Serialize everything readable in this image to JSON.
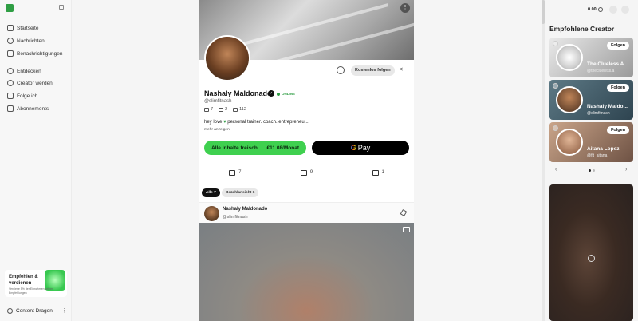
{
  "sidebar": {
    "nav": [
      {
        "label": "Startseite",
        "icon": "home-icon"
      },
      {
        "label": "Nachrichten",
        "icon": "chat-icon"
      },
      {
        "label": "Benachrichtigungen",
        "icon": "bell-icon"
      },
      {
        "label": "Entdecken",
        "icon": "search-icon"
      },
      {
        "label": "Creator werden",
        "icon": "plus-circle-icon"
      },
      {
        "label": "Folge ich",
        "icon": "users-icon"
      },
      {
        "label": "Abonnements",
        "icon": "star-icon"
      }
    ],
    "promo": {
      "title": "Empfehlen & verdienen",
      "subtitle": "Verdiene 5% der Einnahmen deiner Empfehlungen"
    },
    "user": {
      "name": "Content Dragon",
      "more": "⋮"
    }
  },
  "profile": {
    "name": "Nashaly Maldonado",
    "status": "ONLINE",
    "handle": "@slimfitnash",
    "follow_free_label": "Kostenlos folgen",
    "stats": [
      {
        "value": "7",
        "icon": "photo-icon"
      },
      {
        "value": "2",
        "icon": "cart-icon"
      },
      {
        "value": "112",
        "icon": "users-icon"
      }
    ],
    "bio_prefix": "hey love",
    "bio_suffix": "personal trainer. coach. entrepreneu...",
    "more_label": "mehr anzeigen",
    "subscribe_label": "Alle Inhalte freisch...",
    "subscribe_price": "€11.08/Monat",
    "gpay_label": "Pay"
  },
  "tabs": [
    {
      "label": "7",
      "icon": "image-icon"
    },
    {
      "label": "9",
      "icon": "grid-icon"
    },
    {
      "label": "1",
      "icon": "shop-icon"
    }
  ],
  "filters": {
    "all": "Alle 7",
    "paid": "Bezahlansicht 1"
  },
  "post": {
    "name": "Nashaly Maldonado",
    "handle": "@slimfitnash"
  },
  "right": {
    "balance": "0.00",
    "title": "Empfohlene Creator",
    "creators": [
      {
        "name": "The Clueless A...",
        "handle": "@theclueless.a",
        "follow": "Folgen"
      },
      {
        "name": "Nashaly Maldo...",
        "handle": "@slimfitnash",
        "follow": "Folgen"
      },
      {
        "name": "Aitana Lopez",
        "handle": "@fit_aitana",
        "follow": "Folgen"
      }
    ]
  },
  "colors": {
    "accent": "#3fd04f",
    "online": "#2f9e44"
  }
}
